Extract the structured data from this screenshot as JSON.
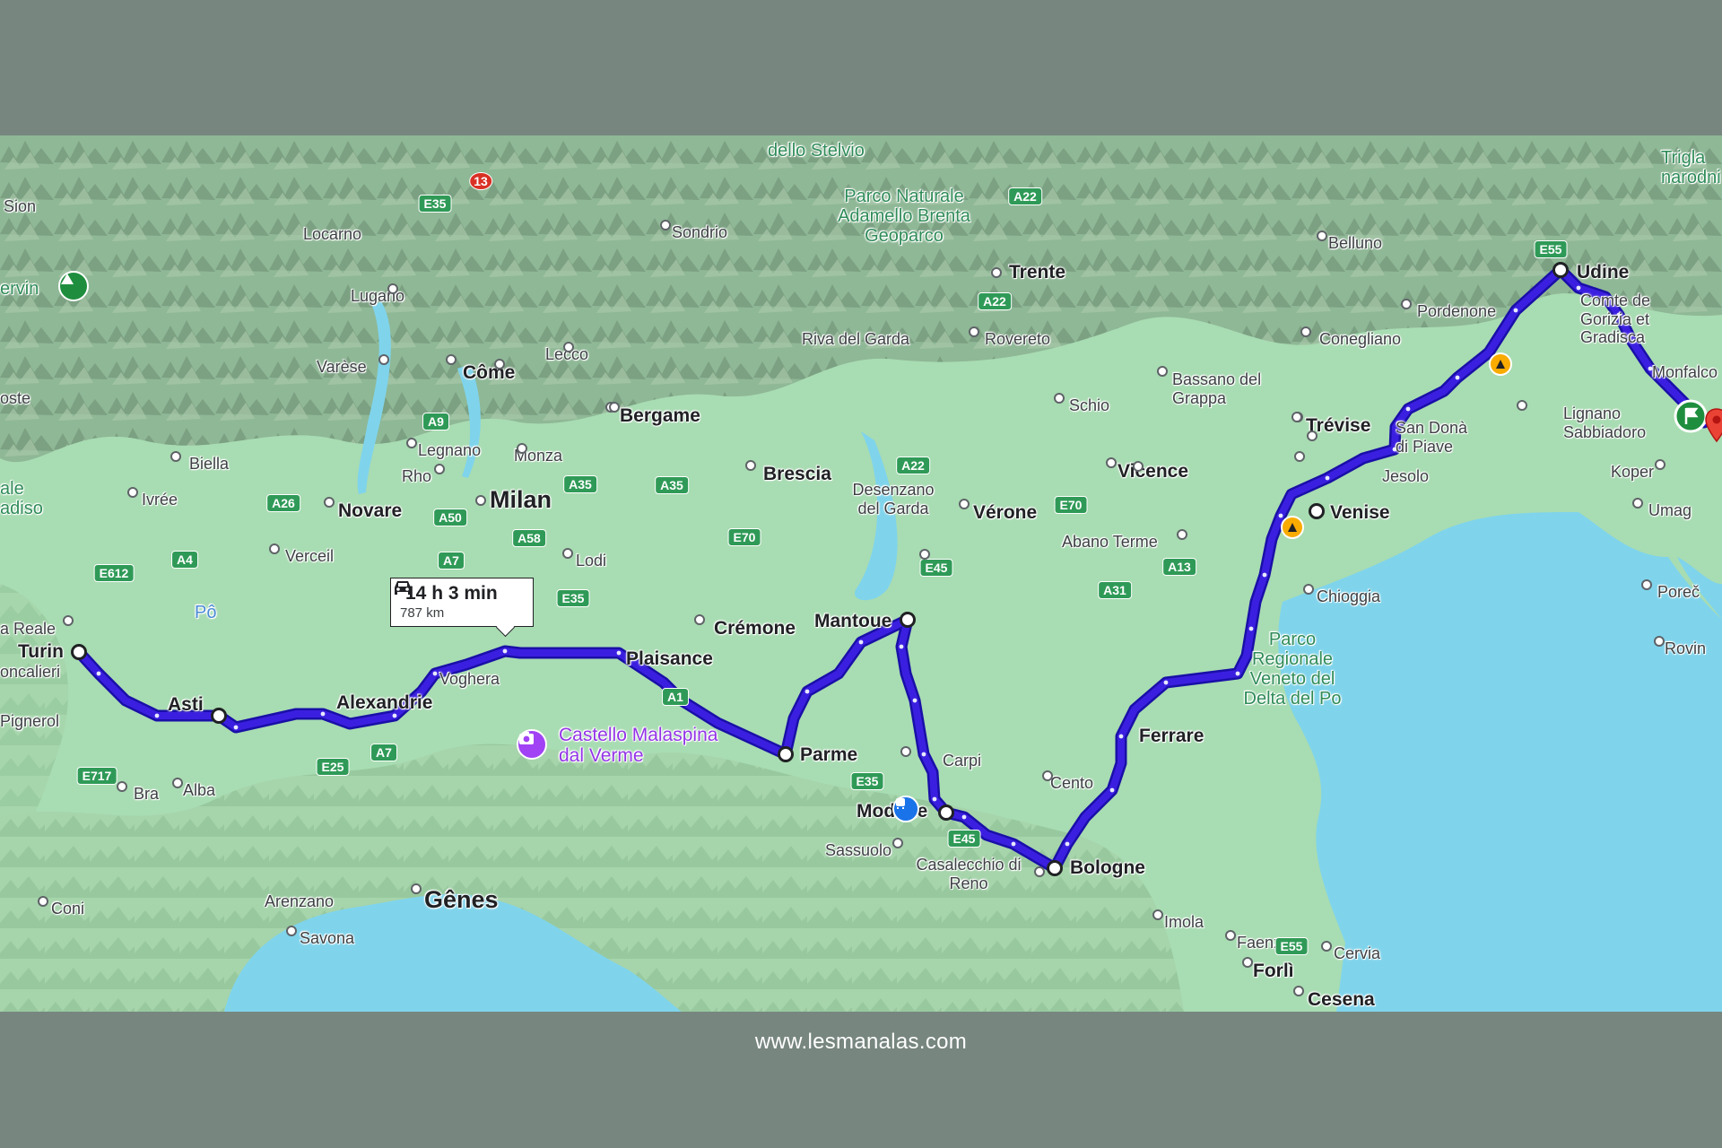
{
  "route": {
    "duration": "14 h 3 min",
    "distance": "787 km",
    "mode_icon": "car-icon",
    "route_color": "#3b1fe0"
  },
  "colors": {
    "background": "#77867f",
    "land": "#a8dcb2",
    "sea": "#7fd4ec",
    "mountains": "#7a9a7c"
  },
  "cities": {
    "milan": "Milan",
    "turin": "Turin",
    "asti": "Asti",
    "alexandrie": "Alexandrie",
    "voghera": "Voghera",
    "plaisance": "Plaisance",
    "parme": "Parme",
    "mantoue": "Mantoue",
    "modene": "Modène",
    "carpi": "Carpi",
    "bologne": "Bologne",
    "ferrare": "Ferrare",
    "venise": "Venise",
    "udine": "Udine",
    "genes": "Gênes",
    "bergame": "Bergame",
    "brescia": "Brescia",
    "verone": "Vérone",
    "vicence": "Vicence",
    "trevise": "Trévise",
    "trente": "Trente",
    "come": "Côme",
    "novare": "Novare",
    "cremone": "Crémone"
  },
  "towns": {
    "sion": "Sion",
    "locarno": "Locarno",
    "lugano": "Lugano",
    "varese": "Varèse",
    "lecco": "Lecco",
    "sondrio": "Sondrio",
    "biella": "Biella",
    "legnano": "Legnano",
    "monza": "Monza",
    "rho": "Rho",
    "ivree": "Ivrée",
    "verceil": "Verceil",
    "lodi": "Lodi",
    "moncalieri": "oncalieri",
    "pignerol": "Pignerol",
    "bra": "Bra",
    "alba": "Alba",
    "coni": "Coni",
    "arenzano": "Arenzano",
    "savona": "Savona",
    "sassuolo": "Sassuolo",
    "casalecchio": "Casalecchio di Reno",
    "cento": "Cento",
    "imola": "Imola",
    "faenza": "Faenza",
    "forli": "Forlì",
    "cesena": "Cesena",
    "cervia": "Cervia",
    "chioggia": "Chioggia",
    "jesolo": "Jesolo",
    "san_dona": "San Donà di Piave",
    "abano": "Abano Terme",
    "bassano": "Bassano del Grappa",
    "schio": "Schio",
    "rovereto": "Rovereto",
    "riva": "Riva del Garda",
    "desenzano": "Desenzano del Garda",
    "conegliano": "Conegliano",
    "pordenone": "Pordenone",
    "belluno": "Belluno",
    "gorizia": "Comte de Gorizia et Gradisca",
    "monfalcone": "Monfalco",
    "lignano": "Lignano Sabbiadoro",
    "koper": "Koper",
    "umag": "Umag",
    "porec": "Poreč",
    "rovinj": "Rovin",
    "reale": "a Reale",
    "oste": "oste",
    "po_river": "Pô"
  },
  "parks": {
    "stelvio": "dello Stelvio",
    "adamello": "Parco Naturale Adamello Brenta Geoparco",
    "delta_po": "Parco Regionale Veneto del Delta del Po",
    "triglav": "Trigla narodni",
    "cervin": "ervin",
    "ale": "ale adiso"
  },
  "poi": {
    "castello": "Castello Malaspina dal Verme"
  },
  "road_shields": [
    "E35",
    "13",
    "A22",
    "A22",
    "A9",
    "A35",
    "A35",
    "A26",
    "A50",
    "A58",
    "A7",
    "A4",
    "E612",
    "E35",
    "E70",
    "E70",
    "E45",
    "A13",
    "A31",
    "A1",
    "E35",
    "E45",
    "A7",
    "E25",
    "E717",
    "E55",
    "E55",
    "A22"
  ],
  "footer": "www.lesmanalas.com"
}
